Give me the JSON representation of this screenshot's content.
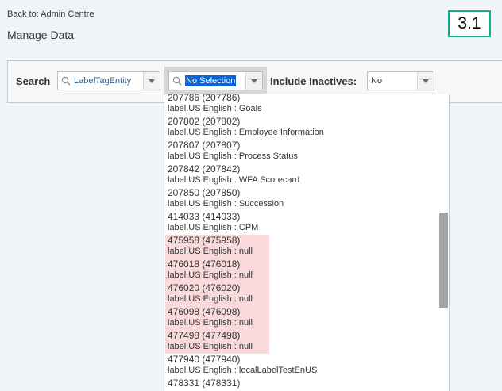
{
  "header": {
    "back_link": "Back to: Admin Centre",
    "title": "Manage Data",
    "version": "3.1"
  },
  "toolbar": {
    "search_label": "Search",
    "entity_value": "LabelTagEntity",
    "selection_value": "No Selection",
    "inactives_label": "Include Inactives:",
    "inactives_value": "No"
  },
  "dropdown": {
    "options": [
      {
        "id": "207786 (207786)",
        "label": "label.US English :  Goals",
        "highlighted": false
      },
      {
        "id": "207802 (207802)",
        "label": "label.US English :  Employee Information",
        "highlighted": false
      },
      {
        "id": "207807 (207807)",
        "label": "label.US English :  Process Status",
        "highlighted": false
      },
      {
        "id": "207842 (207842)",
        "label": "label.US English :  WFA Scorecard",
        "highlighted": false
      },
      {
        "id": "207850 (207850)",
        "label": "label.US English :  Succession",
        "highlighted": false
      },
      {
        "id": "414033 (414033)",
        "label": "label.US English :  CPM",
        "highlighted": false
      },
      {
        "id": "475958 (475958)",
        "label": "label.US English :  null",
        "highlighted": true
      },
      {
        "id": "476018 (476018)",
        "label": "label.US English :  null",
        "highlighted": true
      },
      {
        "id": "476020 (476020)",
        "label": "label.US English :  null",
        "highlighted": true
      },
      {
        "id": "476098 (476098)",
        "label": "label.US English :  null",
        "highlighted": true
      },
      {
        "id": "477498 (477498)",
        "label": "label.US English :  null",
        "highlighted": true
      },
      {
        "id": "477940 (477940)",
        "label": "label.US English :  localLabelTestEnUS",
        "highlighted": false
      },
      {
        "id": "478331 (478331)",
        "label": "",
        "highlighted": false
      }
    ]
  },
  "colors": {
    "page_background": "#eff4f9",
    "badge_border": "#1aa98a",
    "highlight": "#f9d9d9",
    "selected_text_bg": "#0a64d6",
    "link_text": "#346187"
  },
  "icons": {
    "search": "search-icon",
    "dropdown": "chevron-down-icon"
  }
}
